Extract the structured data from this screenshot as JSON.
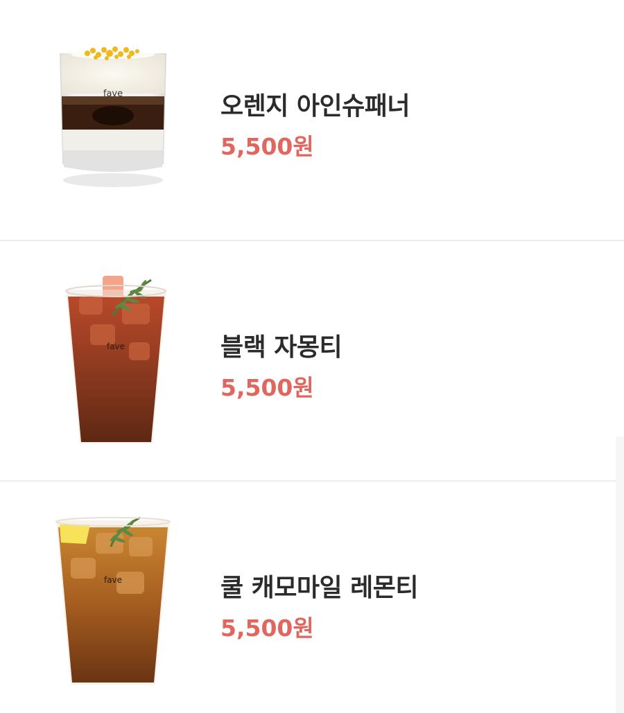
{
  "colors": {
    "price": "#e0665e",
    "name": "#2b2b2b",
    "divider": "#ececec",
    "background": "#ffffff"
  },
  "menu": {
    "items": [
      {
        "name": "오렌지 아인슈패너",
        "price": "5,500원",
        "image_label": "fave"
      },
      {
        "name": "블랙 자몽티",
        "price": "5,500원",
        "image_label": "fave"
      },
      {
        "name": "쿨 캐모마일 레몬티",
        "price": "5,500원",
        "image_label": "fave"
      }
    ]
  }
}
